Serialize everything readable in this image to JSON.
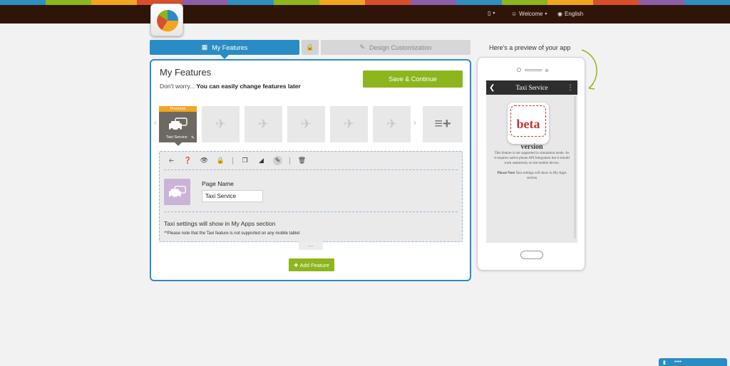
{
  "stripe_colors": [
    "#2e8fc0",
    "#8db51e",
    "#f2a51e",
    "#d94f2b",
    "#8a5fa8",
    "#2e8fc0",
    "#8db51e",
    "#f2a51e",
    "#d94f2b",
    "#8a5fa8",
    "#2e8fc0",
    "#8db51e",
    "#f2a51e",
    "#d94f2b",
    "#8a5fa8",
    "#2e8fc0"
  ],
  "header": {
    "welcome_label": "Welcome",
    "language_label": "English"
  },
  "tabs": {
    "my_features": "My Features",
    "design_customization": "Design Customization"
  },
  "panel": {
    "title": "My Features",
    "subtitle_prefix": "Don't worry...",
    "subtitle_bold": "You can easily change features later",
    "save_button": "Save & Continue",
    "feature_premium_badge": "Premium",
    "feature_active_label": "Taxi Service",
    "page_name_label": "Page Name",
    "page_name_value": "Taxi Service",
    "info_line": "Taxi settings will show in My Apps section",
    "note_line": "**Please note that the Taxi feature is not supported on any mobile tablet",
    "add_feature_button": "Add Feature"
  },
  "preview": {
    "label": "Here's a preview of your app",
    "app_title": "Taxi Service",
    "beta_word": "beta",
    "beta_version": "version",
    "text1": "This feature is not supported in simulation mode. As it requires native phone API Integration but it should work seamlessly on the mobile device.",
    "note_bold": "Please Note",
    "note_text": "Taxi settings will show in My Apps section"
  },
  "colors": {
    "accent_blue": "#2a8cc4",
    "accent_green": "#8db51e",
    "header_bg": "#2f1508",
    "premium_orange": "#f2a51e"
  }
}
